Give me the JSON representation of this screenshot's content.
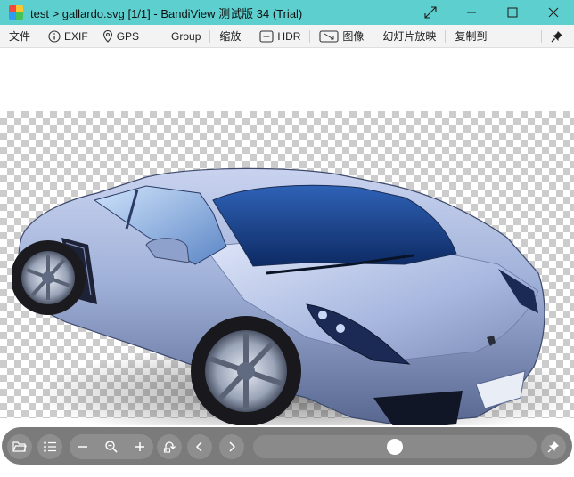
{
  "window": {
    "title": "test > gallardo.svg  [1/1] - BandiView 测试版 34 (Trial)",
    "accent_color": "#5ecfcf"
  },
  "window_controls": {
    "fullscreen_icon": "expand-diagonal-icon",
    "minimize_icon": "minimize-icon",
    "maximize_icon": "maximize-icon",
    "close_icon": "close-icon"
  },
  "menu": {
    "file": "文件",
    "exif": "EXIF",
    "gps": "GPS",
    "group": "Group",
    "zoom": "缩放",
    "hdr": "HDR",
    "image": "图像",
    "slideshow": "幻灯片放映",
    "copy_to": "复制到"
  },
  "image_view": {
    "background": "transparency-checkerboard",
    "image_subject": "silver-blue sports car"
  },
  "bottom_toolbar": {
    "buttons": [
      "open-folder-icon",
      "list-icon",
      "zoom-out-minus-icon",
      "magnifier-icon",
      "zoom-in-plus-icon",
      "rotate-icon",
      "previous-icon",
      "next-icon",
      "pin-icon"
    ],
    "slider_position_fraction": 0.5
  }
}
